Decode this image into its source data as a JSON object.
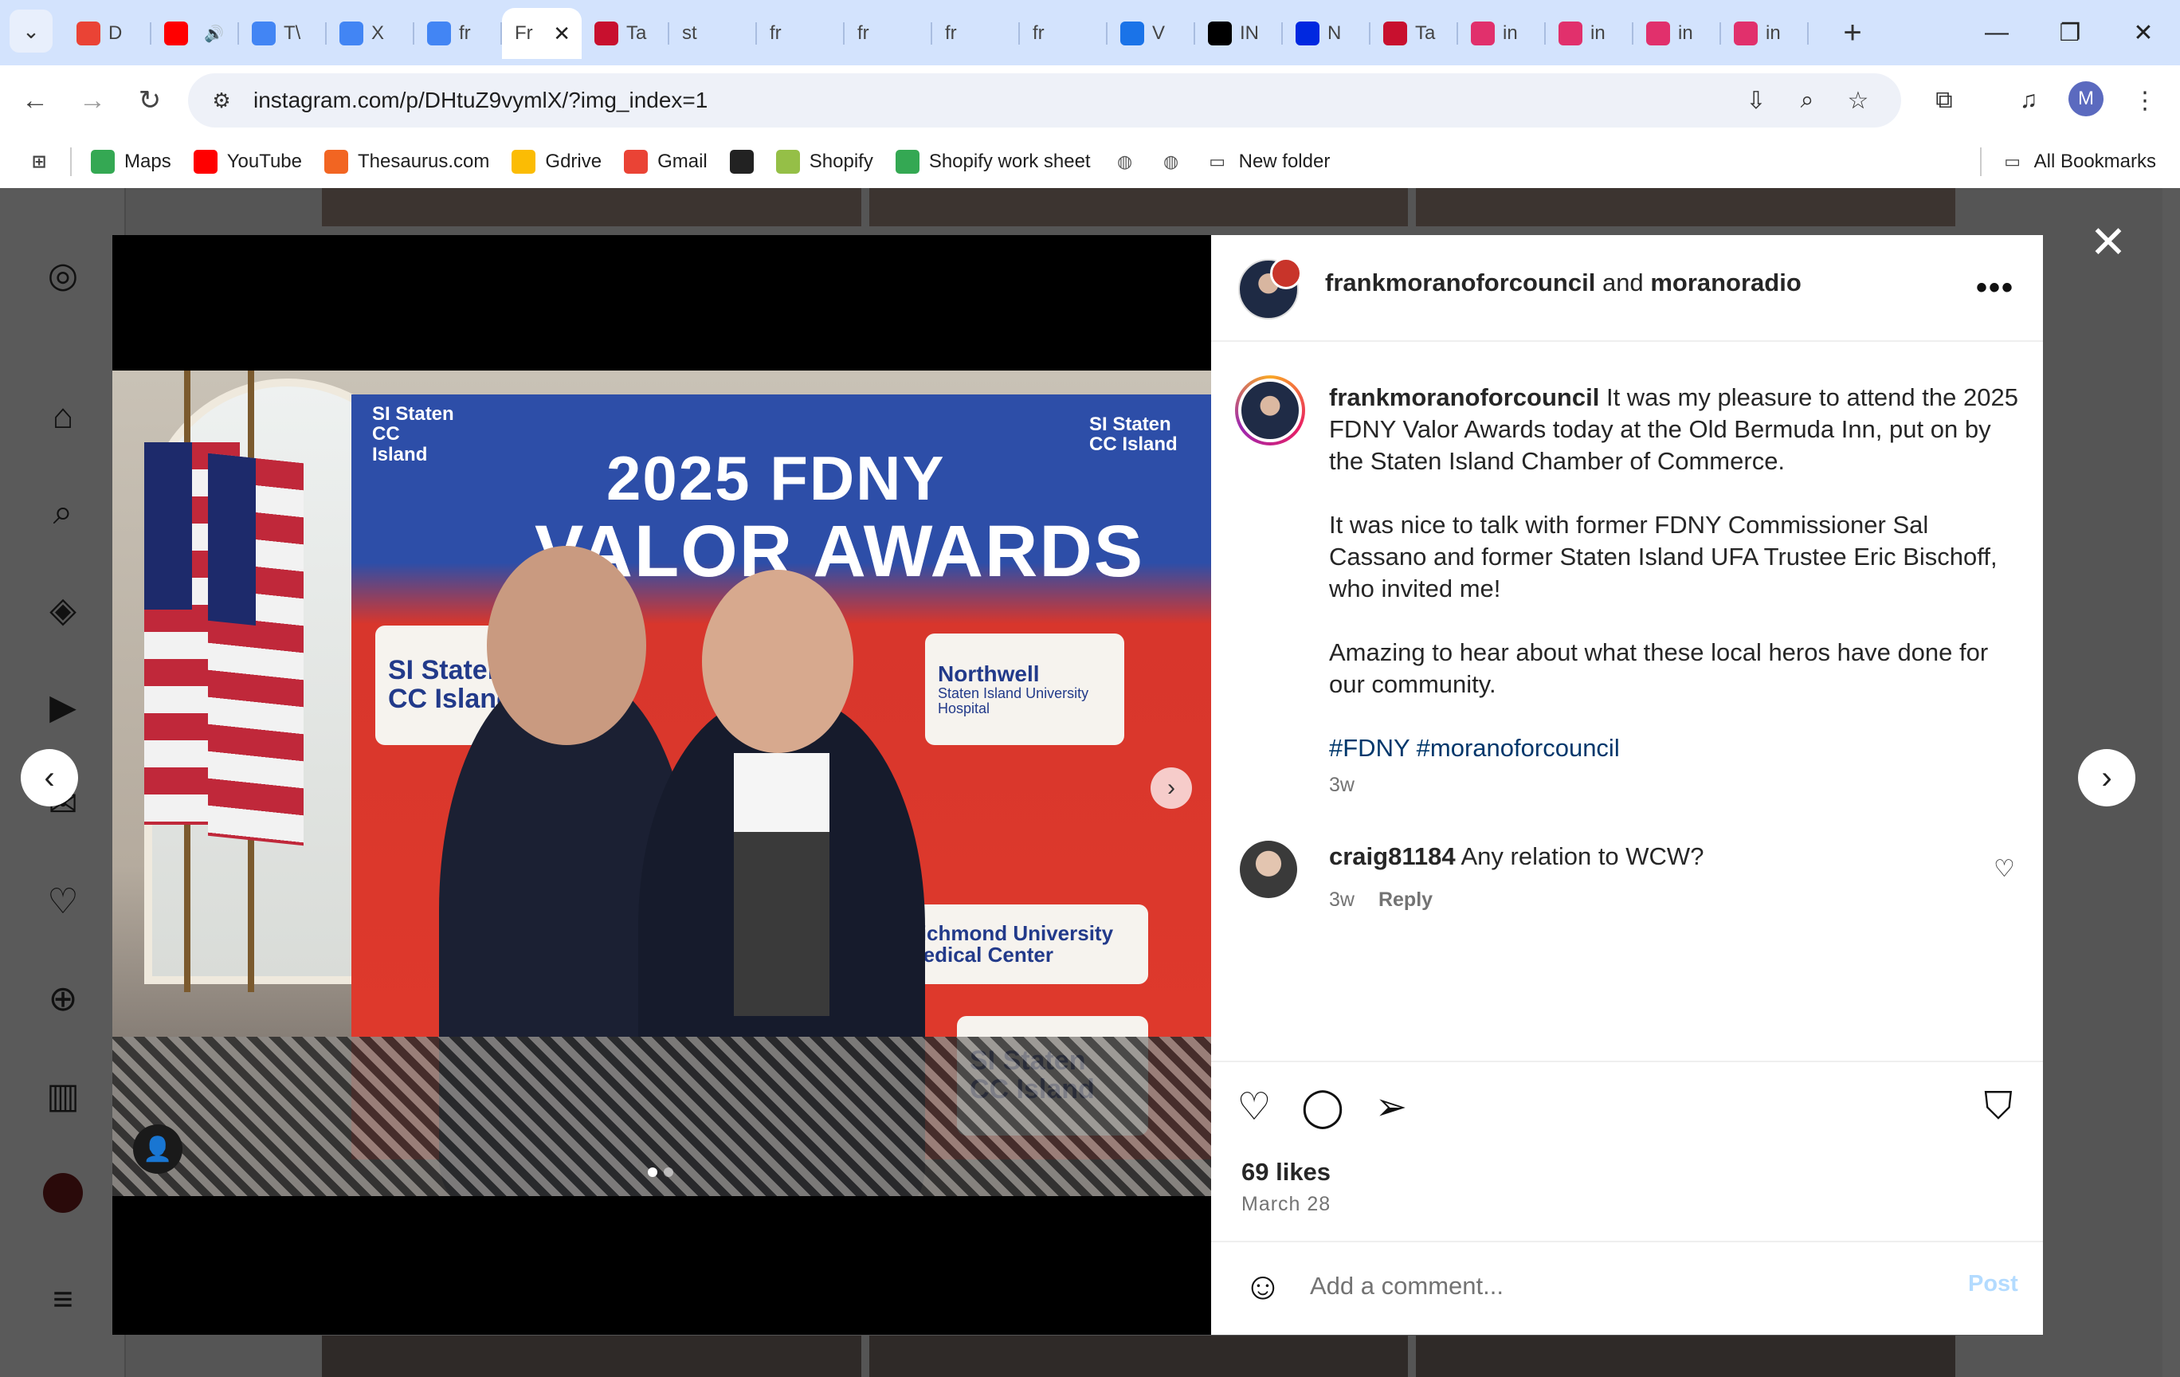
{
  "browser": {
    "tabs": [
      {
        "label": "D",
        "icon": "gmail-icon",
        "color": "#ea4335"
      },
      {
        "label": "",
        "icon": "youtube-icon",
        "color": "#ff0000",
        "audio": true
      },
      {
        "label": "T\\",
        "icon": "docs-icon",
        "color": "#4285f4"
      },
      {
        "label": "X",
        "icon": "docs-icon",
        "color": "#4285f4"
      },
      {
        "label": "fr",
        "icon": "google-icon",
        "color": "#4285f4"
      },
      {
        "label": "Fr",
        "icon": "",
        "color": "#ffffff",
        "active": true
      },
      {
        "label": "Ta",
        "icon": "nypost-icon",
        "color": "#c8102e"
      },
      {
        "label": "st",
        "icon": "",
        "color": "#d3e3fd"
      },
      {
        "label": "fr",
        "icon": "",
        "color": "#d3e3fd"
      },
      {
        "label": "fr",
        "icon": "",
        "color": "#d3e3fd"
      },
      {
        "label": "fr",
        "icon": "",
        "color": "#d3e3fd"
      },
      {
        "label": "fr",
        "icon": "",
        "color": "#d3e3fd"
      },
      {
        "label": "V",
        "icon": "globe-icon",
        "color": "#1a73e8"
      },
      {
        "label": "IN",
        "icon": "x-icon",
        "color": "#000000"
      },
      {
        "label": "N",
        "icon": "aol-icon",
        "color": "#0028e0"
      },
      {
        "label": "Ta",
        "icon": "nypost-icon",
        "color": "#c8102e"
      },
      {
        "label": "in",
        "icon": "instagram-icon",
        "color": "#e1306c"
      },
      {
        "label": "in",
        "icon": "instagram-icon",
        "color": "#e1306c"
      },
      {
        "label": "in",
        "icon": "instagram-icon",
        "color": "#e1306c"
      },
      {
        "label": "in",
        "icon": "instagram-icon",
        "color": "#e1306c"
      }
    ],
    "url": "instagram.com/p/DHtuZ9vymlX/?img_index=1",
    "profile_initial": "M",
    "bookmarks": [
      {
        "label": "Maps",
        "icon": "maps-icon",
        "color": "#34a853"
      },
      {
        "label": "YouTube",
        "icon": "youtube-icon",
        "color": "#ff0000"
      },
      {
        "label": "Thesaurus.com",
        "icon": "thesaurus-icon",
        "color": "#f26522"
      },
      {
        "label": "Gdrive",
        "icon": "drive-icon",
        "color": "#fbbc04"
      },
      {
        "label": "Gmail",
        "icon": "gmail-icon",
        "color": "#ea4335"
      },
      {
        "label": "",
        "icon": "bbc-icon",
        "color": "#222222"
      },
      {
        "label": "Shopify",
        "icon": "shopify-icon",
        "color": "#95bf47"
      },
      {
        "label": "Shopify work sheet",
        "icon": "drive-icon",
        "color": "#34a853"
      },
      {
        "label": "",
        "icon": "globe-icon",
        "color": "#555555"
      },
      {
        "label": "",
        "icon": "globe-icon",
        "color": "#555555"
      },
      {
        "label": "New folder",
        "icon": "folder-icon",
        "color": "#444444"
      }
    ],
    "all_bookmarks": "All Bookmarks"
  },
  "photo": {
    "banner_line1": "2025 FDNY",
    "banner_line2": "VALOR AWARDS",
    "logos": [
      "Staten Island Chamber of Commerce",
      "Northwell Staten Island University Hospital",
      "Richmond University Medical Center"
    ]
  },
  "post": {
    "header_user1": "frankmoranoforcouncil",
    "header_and": "and",
    "header_user2": "moranoradio",
    "caption_user": "frankmoranoforcouncil",
    "caption_p1": "It was my pleasure to attend the 2025 FDNY Valor Awards today at the Old Bermuda Inn, put on by the Staten Island Chamber of Commerce.",
    "caption_p2": "It was nice to talk with former FDNY Commissioner Sal Cassano and former Staten Island UFA Trustee Eric Bischoff, who invited me!",
    "caption_p3": "Amazing to hear about what these local heros have done for our community.",
    "hashtags": "#FDNY #moranoforcouncil",
    "caption_time": "3w",
    "comment_user": "craig81184",
    "comment_text": "Any relation to WCW?",
    "comment_time": "3w",
    "comment_reply": "Reply",
    "likes": "69 likes",
    "date": "March 28",
    "comment_placeholder": "Add a comment...",
    "post_label": "Post"
  }
}
